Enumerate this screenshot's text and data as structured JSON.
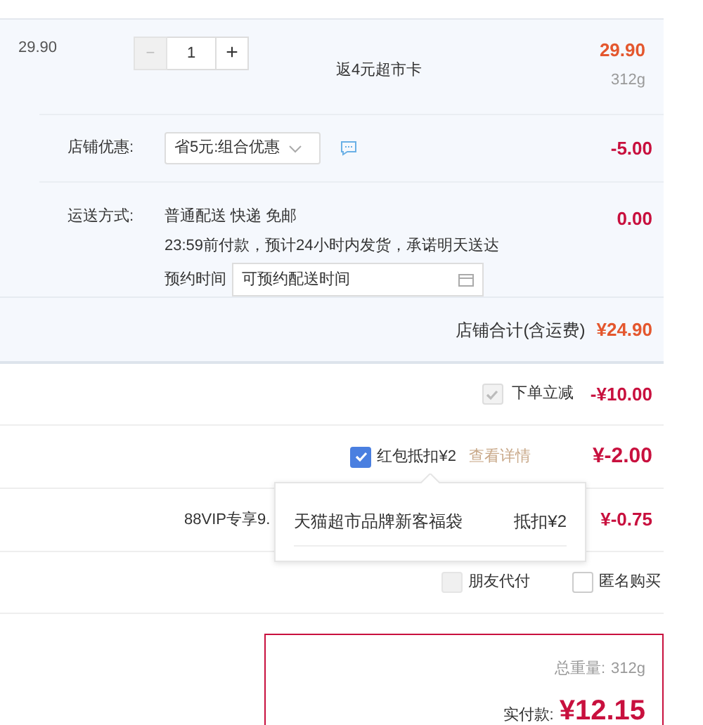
{
  "item": {
    "unit_price": "29.90",
    "quantity": "1",
    "minus": "−",
    "plus": "+",
    "promo": "返4元超市卡",
    "total": "29.90",
    "weight": "312g"
  },
  "shop_discount": {
    "label": "店铺优惠:",
    "value": "省5元:组合优惠",
    "amount": "-5.00"
  },
  "shipping": {
    "label": "运送方式:",
    "method": "普通配送 快递 免邮",
    "note": "23:59前付款，预计24小时内发货，承诺明天送达",
    "schedule_label": "预约时间",
    "schedule_placeholder": "可预约配送时间",
    "amount": "0.00"
  },
  "shop_total": {
    "label": "店铺合计(含运费)",
    "amount": "¥24.90"
  },
  "instant_discount": {
    "checked": true,
    "disabled": true,
    "label": "下单立减",
    "amount": "-¥10.00"
  },
  "red_packet": {
    "checked": true,
    "disabled": false,
    "label": "红包抵扣¥2",
    "link": "查看详情",
    "amount": "¥-2.00"
  },
  "vip": {
    "label": "88VIP专享9.",
    "amount": "¥-0.75"
  },
  "popup": {
    "name": "天猫超市品牌新客福袋",
    "deduct": "抵扣¥2"
  },
  "options": [
    {
      "label": "朋友代付",
      "checked": false,
      "disabled": true
    },
    {
      "label": "匿名购买",
      "checked": false,
      "disabled": false
    }
  ],
  "summary": {
    "weight_label": "总重量:",
    "weight": "312g",
    "pay_label": "实付款:",
    "pay": "¥12.15"
  }
}
